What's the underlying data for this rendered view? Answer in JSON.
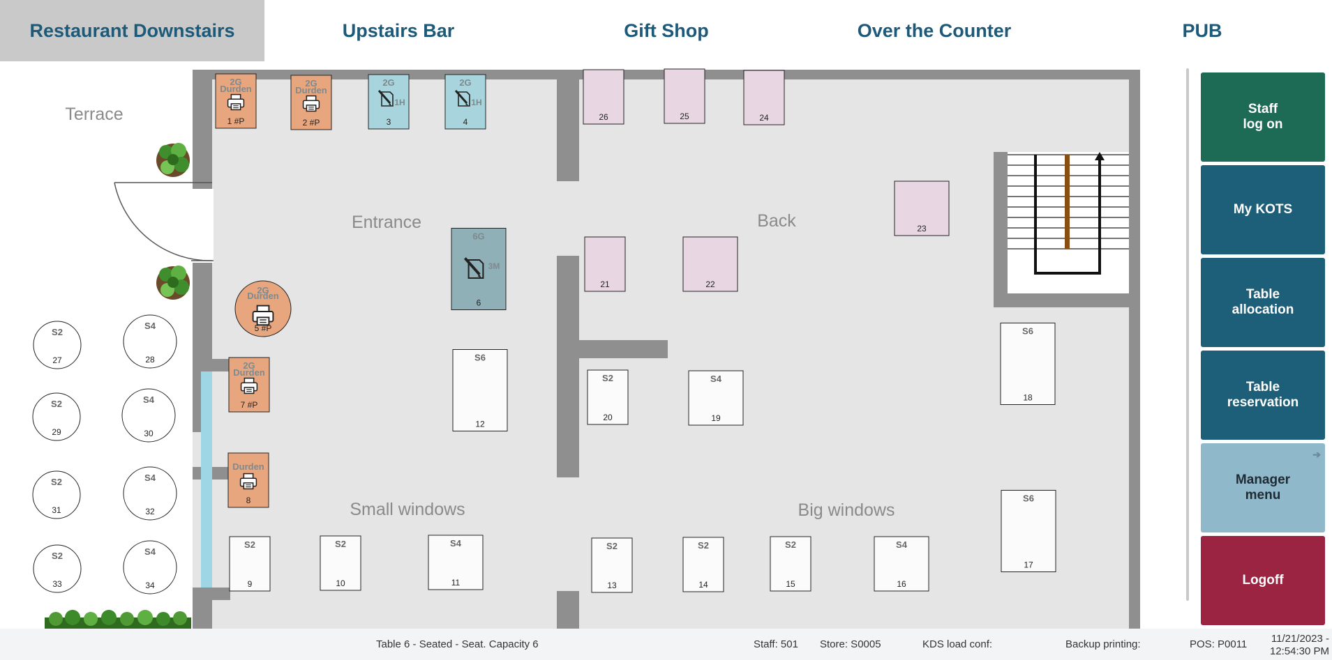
{
  "tabs": [
    "Restaurant Downstairs",
    "Upstairs Bar",
    "Gift Shop",
    "Over the Counter",
    "PUB"
  ],
  "active_tab": "Restaurant Downstairs",
  "areas": {
    "terrace": "Terrace",
    "entrance": "Entrance",
    "back": "Back",
    "small_windows": "Small windows",
    "big_windows": "Big windows"
  },
  "tables": [
    {
      "id": "1",
      "num": "1 #P",
      "shape": "rect",
      "status": "occupied",
      "top": "2G",
      "mid": "Durden",
      "icon": "printer-icon"
    },
    {
      "id": "2",
      "num": "2 #P",
      "shape": "rect",
      "status": "occupied",
      "top": "2G",
      "mid": "Durden",
      "icon": "printer-icon"
    },
    {
      "id": "3",
      "num": "3",
      "shape": "rect",
      "status": "ordered",
      "top": "2G",
      "side": "1H",
      "icon": "edit-icon"
    },
    {
      "id": "4",
      "num": "4",
      "shape": "rect",
      "status": "ordered",
      "top": "2G",
      "side": "1H",
      "icon": "edit-icon"
    },
    {
      "id": "5",
      "num": "5 #P",
      "shape": "circle",
      "status": "occupied",
      "top": "2G",
      "mid": "Durden",
      "icon": "printer-icon"
    },
    {
      "id": "6",
      "num": "6",
      "shape": "rect",
      "status": "selected",
      "top": "6G",
      "side": "3M",
      "icon": "edit-icon"
    },
    {
      "id": "7",
      "num": "7 #P",
      "shape": "rect",
      "status": "occupied",
      "top": "2G",
      "mid": "Durden",
      "icon": "printer-icon"
    },
    {
      "id": "8",
      "num": "8",
      "shape": "rect",
      "status": "occupied",
      "mid": "Durden",
      "icon": "printer-icon"
    },
    {
      "id": "9",
      "num": "9",
      "shape": "rect",
      "status": "free",
      "top": "S2"
    },
    {
      "id": "10",
      "num": "10",
      "shape": "rect",
      "status": "free",
      "top": "S2"
    },
    {
      "id": "11",
      "num": "11",
      "shape": "rect",
      "status": "free",
      "top": "S4"
    },
    {
      "id": "12",
      "num": "12",
      "shape": "rect",
      "status": "free",
      "top": "S6"
    },
    {
      "id": "13",
      "num": "13",
      "shape": "rect",
      "status": "free",
      "top": "S2"
    },
    {
      "id": "14",
      "num": "14",
      "shape": "rect",
      "status": "free",
      "top": "S2"
    },
    {
      "id": "15",
      "num": "15",
      "shape": "rect",
      "status": "free",
      "top": "S2"
    },
    {
      "id": "16",
      "num": "16",
      "shape": "rect",
      "status": "free",
      "top": "S4"
    },
    {
      "id": "17",
      "num": "17",
      "shape": "rect",
      "status": "free",
      "top": "S6"
    },
    {
      "id": "18",
      "num": "18",
      "shape": "rect",
      "status": "free",
      "top": "S6"
    },
    {
      "id": "19",
      "num": "19",
      "shape": "rect",
      "status": "free",
      "top": "S4"
    },
    {
      "id": "20",
      "num": "20",
      "shape": "rect",
      "status": "free",
      "top": "S2"
    },
    {
      "id": "21",
      "num": "21",
      "shape": "rect",
      "status": "reserved"
    },
    {
      "id": "22",
      "num": "22",
      "shape": "rect",
      "status": "reserved"
    },
    {
      "id": "23",
      "num": "23",
      "shape": "rect",
      "status": "reserved"
    },
    {
      "id": "24",
      "num": "24",
      "shape": "rect",
      "status": "reserved"
    },
    {
      "id": "25",
      "num": "25",
      "shape": "rect",
      "status": "reserved"
    },
    {
      "id": "26",
      "num": "26",
      "shape": "rect",
      "status": "reserved"
    },
    {
      "id": "27",
      "num": "27",
      "shape": "circle",
      "status": "terrace",
      "top": "S2"
    },
    {
      "id": "28",
      "num": "28",
      "shape": "circle",
      "status": "terrace",
      "top": "S4"
    },
    {
      "id": "29",
      "num": "29",
      "shape": "circle",
      "status": "terrace",
      "top": "S2"
    },
    {
      "id": "30",
      "num": "30",
      "shape": "circle",
      "status": "terrace",
      "top": "S4"
    },
    {
      "id": "31",
      "num": "31",
      "shape": "circle",
      "status": "terrace",
      "top": "S2"
    },
    {
      "id": "32",
      "num": "32",
      "shape": "circle",
      "status": "terrace",
      "top": "S4"
    },
    {
      "id": "33",
      "num": "33",
      "shape": "circle",
      "status": "terrace",
      "top": "S2"
    },
    {
      "id": "34",
      "num": "34",
      "shape": "circle",
      "status": "terrace",
      "top": "S4"
    }
  ],
  "side_buttons": [
    {
      "label": "Staff\nlog on",
      "color": "#1e6b55",
      "icon": ""
    },
    {
      "label": "My KOTS",
      "color": "#1d5e78",
      "icon": ""
    },
    {
      "label": "Table\nallocation",
      "color": "#1d5e78",
      "icon": ""
    },
    {
      "label": "Table\nreservation",
      "color": "#1d5e78",
      "icon": ""
    },
    {
      "label": "Manager\nmenu",
      "color": "#90b8cb",
      "icon": "arrow-right-icon"
    },
    {
      "label": "Logoff",
      "color": "#9b2442",
      "icon": ""
    }
  ],
  "status": {
    "table_info": "Table 6 - Seated - Seat. Capacity 6",
    "staff": "Staff: 501",
    "store": "Store: S0005",
    "kds": "KDS load conf:",
    "backup": "Backup printing:",
    "pos": "POS: P0011",
    "date": "11/21/2023 -",
    "time": "12:54:30 PM"
  },
  "colors": {
    "occupied": "#e8a67e",
    "ordered": "#a8d5dd",
    "selected": "#8fb0b7",
    "reserved": "#e8d7e3",
    "free": "#fbfbfb",
    "terrace": "#ffffff",
    "wall": "#8f8f8f",
    "floor": "#e5e5e5",
    "window": "#9fd6e6",
    "tab_text": "#1d5a79",
    "tab_active_bg": "#c9c9c9"
  }
}
